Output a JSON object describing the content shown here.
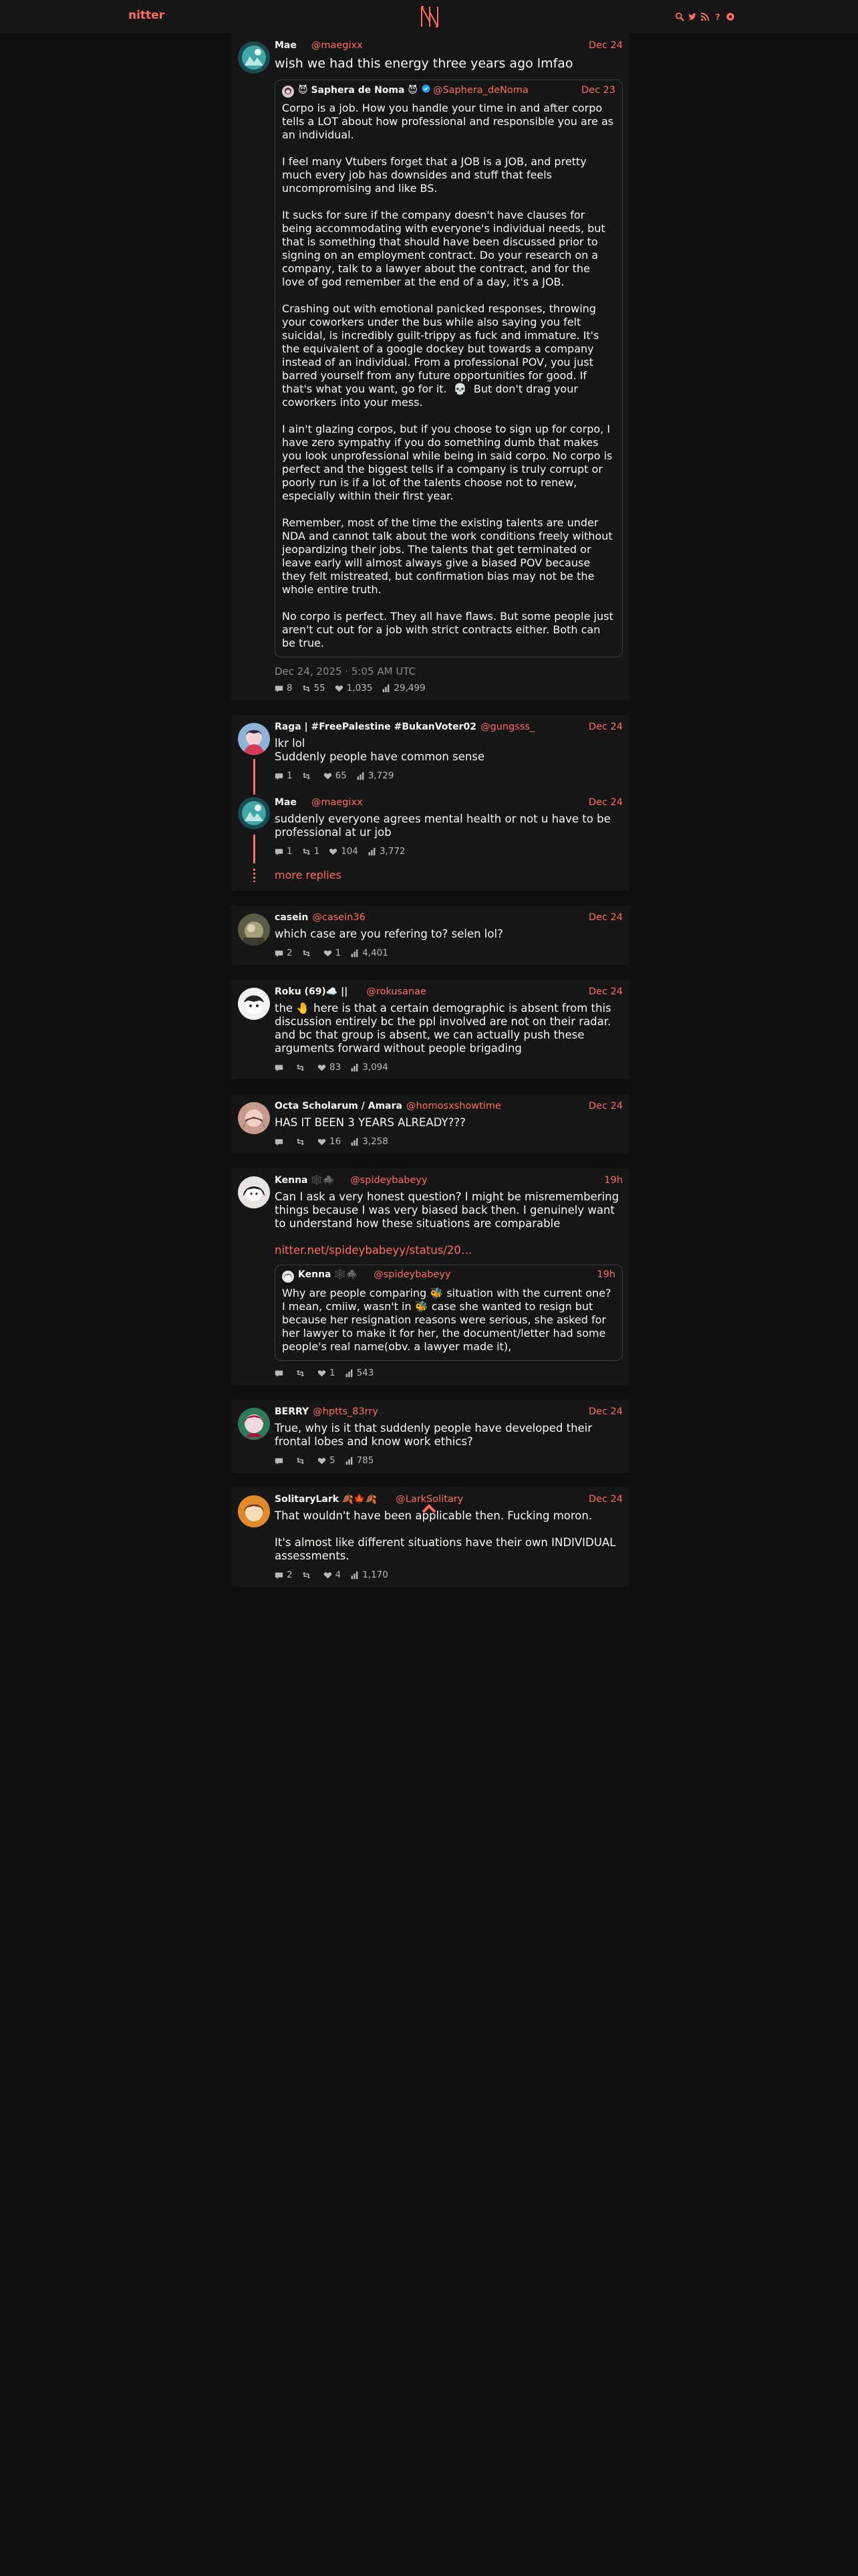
{
  "nav": {
    "brand": "nitter"
  },
  "colors": {
    "accent": "#ff6c60",
    "background": "#0f0f0f",
    "panel": "#161616"
  },
  "icons": [
    "search-icon",
    "rss-icon",
    "info-icon",
    "settings-icon",
    "comment-icon",
    "retweet-icon",
    "heart-icon",
    "views-icon"
  ],
  "main": {
    "fullname": "Mae",
    "username": "@maegixx",
    "date": "Dec 24",
    "text": "wish we had this energy three years ago lmfao",
    "quote": {
      "fullname": "😈 Saphera de Noma 😈",
      "username": "@Saphera_deNoma",
      "date": "Dec 23",
      "text": "Corpo is a job. How you handle your time in and after corpo tells a LOT about how professional and responsible you are as an individual.\n\nI feel many Vtubers forget that a JOB is a JOB, and pretty much every job has downsides and stuff that feels uncompromising and like BS.\n\nIt sucks for sure if the company doesn't have clauses for being accommodating with everyone's individual needs, but that is something that should have been discussed prior to signing on an employment contract. Do your research on a company, talk to a lawyer about the contract, and for the love of god remember at the end of a day, it's a JOB.\n\nCrashing out with emotional panicked responses, throwing your coworkers under the bus while also saying you felt suicidal, is incredibly guilt-trippy as fuck and immature. It's the equivalent of a google dockey but towards a company instead of an individual. From a professional POV, you just barred yourself from any future opportunities for good. If that's what you want, go for it.  💀  But don't drag your coworkers into your mess.\n\nI ain't glazing corpos, but if you choose to sign up for corpo, I have zero sympathy if you do something dumb that makes you look unprofessional while being in said corpo. No corpo is perfect and the biggest tells if a company is truly corrupt or poorly run is if a lot of the talents choose not to renew, especially within their first year.\n\nRemember, most of the time the existing talents are under NDA and cannot talk about the work conditions freely without jeopardizing their jobs. The talents that get terminated or leave early will almost always give a biased POV because they felt mistreated, but confirmation bias may not be the whole entire truth.\n\nNo corpo is perfect. They all have flaws. But some people just aren't cut out for a job with strict contracts either. Both can be true."
    },
    "published": "Dec 24, 2025 · 5:05 AM UTC",
    "stats": {
      "replies": "8",
      "retweets": "55",
      "likes": "1,035",
      "views": "29,499"
    }
  },
  "thread1": {
    "tweets": [
      {
        "fullname": "Raga | #FreePalestine #BukanVoter02",
        "username": "@gungsss_",
        "date": "Dec 24",
        "text": "lkr lol\nSuddenly people have common sense",
        "stats": {
          "replies": "1",
          "retweets": "",
          "likes": "65",
          "views": "3,729"
        }
      },
      {
        "fullname": "Mae",
        "username": "@maegixx",
        "date": "Dec 24",
        "text": "suddenly everyone agrees mental health or not u have to be professional at ur job",
        "stats": {
          "replies": "1",
          "retweets": "1",
          "likes": "104",
          "views": "3,772"
        }
      }
    ],
    "more_replies": "more replies"
  },
  "replies": [
    {
      "fullname": "casein",
      "username": "@casein36",
      "date": "Dec 24",
      "text": "which case are you refering to? selen lol?",
      "stats": {
        "replies": "2",
        "retweets": "",
        "likes": "1",
        "views": "4,401"
      }
    },
    {
      "fullname": "Roku (69)☁️  ||",
      "username": "@rokusanae",
      "date": "Dec 24",
      "text": "the 🤚 here is that a certain demographic is absent from this discussion entirely bc the ppl involved are not on their radar. and bc that group is absent, we can actually push these arguments forward without people brigading",
      "stats": {
        "replies": "",
        "retweets": "",
        "likes": "83",
        "views": "3,094"
      }
    },
    {
      "fullname": "Octa Scholarum / Amara",
      "username": "@homosxshowtime",
      "date": "Dec 24",
      "text": "HAS IT BEEN 3 YEARS ALREADY???",
      "stats": {
        "replies": "",
        "retweets": "",
        "likes": "16",
        "views": "3,258"
      }
    },
    {
      "fullname": "Kenna 🕸️🕷️",
      "username": "@spideybabeyy",
      "date": "19h",
      "text": "Can I ask a very honest question? I might be misremembering things because I was very biased back then. I genuinely want to understand how these situations are comparable",
      "link": "nitter.net/spideybabeyy/status/20…",
      "quote": {
        "fullname": "Kenna 🕸️🕷️",
        "username": "@spideybabeyy",
        "date": "19h",
        "text": "Why are people comparing 🐝 situation with the current one? I mean, cmiiw, wasn't in 🐝 case she wanted to resign but because her resignation reasons were serious, she asked for her lawyer to make it for her, the document/letter had some people's real name(obv. a lawyer made it),"
      },
      "stats": {
        "replies": "",
        "retweets": "",
        "likes": "1",
        "views": "543"
      }
    },
    {
      "fullname": "BERRY",
      "username": "@hptts_83rry",
      "date": "Dec 24",
      "text": "True, why is it that suddenly people have developed their frontal lobes and know work ethics?",
      "stats": {
        "replies": "",
        "retweets": "",
        "likes": "5",
        "views": "785"
      }
    },
    {
      "fullname": "SolitaryLark 🍂🍁🍂",
      "username": "@LarkSolitary",
      "date": "Dec 24",
      "text": "That wouldn't have been applicable then. Fucking moron.\n\nIt's almost like different situations have their own INDIVIDUAL assessments.",
      "stats": {
        "replies": "2",
        "retweets": "",
        "likes": "4",
        "views": "1,170"
      }
    }
  ]
}
